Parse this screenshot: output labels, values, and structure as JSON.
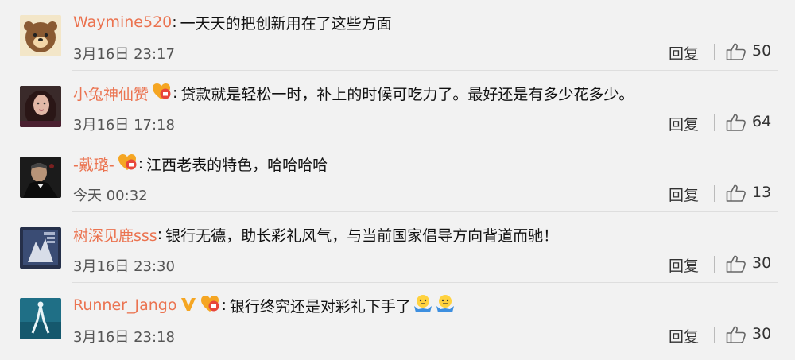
{
  "comments": [
    {
      "user": "Waymine520",
      "badges": [],
      "colon": ":",
      "text": "一天天的把创新用在了这些方面",
      "time": "3月16日 23:17",
      "reply": "回复",
      "likes": "50",
      "avatar": "bear-avatar"
    },
    {
      "user": "小兔神仙赞",
      "badges": [
        "fan-badge"
      ],
      "colon": ":",
      "text": "贷款就是轻松一时，补上的时候可吃力了。最好还是有多少花多少。",
      "time": "3月16日 17:18",
      "reply": "回复",
      "likes": "64",
      "avatar": "woman-avatar"
    },
    {
      "user": "-戴璐-",
      "badges": [
        "fan-badge"
      ],
      "colon": ":",
      "text": "江西老表的特色，哈哈哈哈",
      "time": "今天 00:32",
      "reply": "回复",
      "likes": "13",
      "avatar": "godfather-avatar"
    },
    {
      "user": "树深见鹿sss",
      "badges": [],
      "colon": ":",
      "text": "银行无德，助长彩礼风气，与当前国家倡导方向背道而驰！",
      "time": "3月16日 23:30",
      "reply": "回复",
      "likes": "30",
      "avatar": "poster-avatar"
    },
    {
      "user": "Runner_Jango",
      "badges": [
        "verified-v-badge",
        "fan-badge"
      ],
      "colon": ":",
      "text": "银行终究还是对彩礼下手了",
      "time": "3月16日 23:18",
      "reply": "回复",
      "likes": "30",
      "avatar": "underwater-avatar",
      "emojis": [
        "shrug-emoji",
        "shrug-emoji"
      ]
    }
  ],
  "colors": {
    "username": "#eb7350",
    "text": "#111111",
    "meta": "#555555",
    "background": "#f2f2f2"
  }
}
